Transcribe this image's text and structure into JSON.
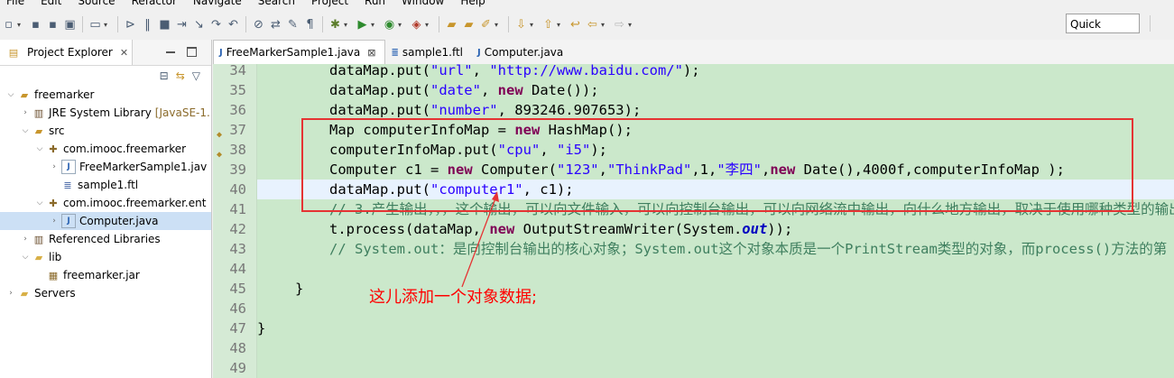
{
  "menu": [
    "File",
    "Edit",
    "Source",
    "Refactor",
    "Navigate",
    "Search",
    "Project",
    "Run",
    "Window",
    "Help"
  ],
  "toolbar": {
    "quick_access": "Quick Access"
  },
  "explorer": {
    "title": "Project Explorer",
    "tree": [
      {
        "label": "freemarker",
        "depth": 0,
        "twisty": "open",
        "icon": "project-icon"
      },
      {
        "label": "JRE System Library",
        "suffix": "[JavaSE-1.",
        "depth": 1,
        "twisty": "closed",
        "icon": "library-icon"
      },
      {
        "label": "src",
        "depth": 1,
        "twisty": "open",
        "icon": "source-folder-icon"
      },
      {
        "label": "com.imooc.freemarker",
        "depth": 2,
        "twisty": "open",
        "icon": "package-icon"
      },
      {
        "label": "FreeMarkerSample1.jav",
        "depth": 3,
        "twisty": "closed",
        "icon": "java-file-icon"
      },
      {
        "label": "sample1.ftl",
        "depth": 3,
        "twisty": "none",
        "icon": "ftl-file-icon"
      },
      {
        "label": "com.imooc.freemarker.ent",
        "depth": 2,
        "twisty": "open",
        "icon": "package-icon"
      },
      {
        "label": "Computer.java",
        "depth": 3,
        "twisty": "closed",
        "icon": "java-file-icon",
        "selected": true
      },
      {
        "label": "Referenced Libraries",
        "depth": 1,
        "twisty": "closed",
        "icon": "library-icon"
      },
      {
        "label": "lib",
        "depth": 1,
        "twisty": "open",
        "icon": "folder-icon"
      },
      {
        "label": "freemarker.jar",
        "depth": 2,
        "twisty": "none",
        "icon": "jar-icon"
      },
      {
        "label": "Servers",
        "depth": 0,
        "twisty": "closed",
        "icon": "folder-icon"
      }
    ]
  },
  "editor": {
    "tabs": [
      {
        "label": "FreeMarkerSample1.java",
        "active": true,
        "close": "⊠"
      },
      {
        "label": "sample1.ftl",
        "active": false
      },
      {
        "label": "Computer.java",
        "active": false
      }
    ],
    "lines": [
      {
        "n": "34",
        "indent": 2,
        "segs": [
          [
            "",
            "dataMap.put("
          ],
          [
            "str",
            "\"url\""
          ],
          [
            "",
            ", "
          ],
          [
            "str",
            "\"http://www.baidu.com/\""
          ],
          [
            "",
            ");"
          ]
        ]
      },
      {
        "n": "35",
        "indent": 2,
        "segs": [
          [
            "",
            "dataMap.put("
          ],
          [
            "str",
            "\"date\""
          ],
          [
            "",
            ", "
          ],
          [
            "kw",
            "new"
          ],
          [
            "",
            " Date());"
          ]
        ]
      },
      {
        "n": "36",
        "indent": 2,
        "segs": [
          [
            "",
            "dataMap.put("
          ],
          [
            "str",
            "\"number\""
          ],
          [
            "",
            ", 893246.907653);"
          ]
        ]
      },
      {
        "n": "37",
        "indent": 2,
        "mark": true,
        "segs": [
          [
            "",
            "Map computerInfoMap = "
          ],
          [
            "kw",
            "new"
          ],
          [
            "",
            " HashMap();"
          ]
        ]
      },
      {
        "n": "38",
        "indent": 2,
        "mark": true,
        "segs": [
          [
            "",
            "computerInfoMap.put("
          ],
          [
            "str",
            "\"cpu\""
          ],
          [
            "",
            ", "
          ],
          [
            "str",
            "\"i5\""
          ],
          [
            "",
            ");"
          ]
        ]
      },
      {
        "n": "39",
        "indent": 2,
        "segs": [
          [
            "",
            "Computer c1 = "
          ],
          [
            "kw",
            "new"
          ],
          [
            "",
            " Computer("
          ],
          [
            "str",
            "\"123\""
          ],
          [
            "",
            ","
          ],
          [
            "str",
            "\"ThinkPad\""
          ],
          [
            "",
            ",1,"
          ],
          [
            "str",
            "\"李四\""
          ],
          [
            "",
            ","
          ],
          [
            "kw",
            "new"
          ],
          [
            "",
            " Date(),4000f,computerInfoMap );"
          ]
        ]
      },
      {
        "n": "40",
        "indent": 2,
        "current": true,
        "segs": [
          [
            "",
            "dataMap.put("
          ],
          [
            "str",
            "\"computer1\""
          ],
          [
            "",
            ", c1);"
          ]
        ]
      },
      {
        "n": "41",
        "indent": 2,
        "segs": [
          [
            "cm",
            "// 3.产生输出，，，这个输出，可以向文件输入，可以向控制台输出，可以向网络流中输出，向什么地方输出，取决于使用哪种类型的输出"
          ]
        ]
      },
      {
        "n": "42",
        "indent": 2,
        "segs": [
          [
            "",
            "t.process(dataMap, "
          ],
          [
            "kw",
            "new"
          ],
          [
            "",
            " OutputStreamWriter(System."
          ],
          [
            "fld",
            "out"
          ],
          [
            "",
            "));"
          ]
        ]
      },
      {
        "n": "43",
        "indent": 2,
        "segs": [
          [
            "cm",
            "// System.out：是向控制台输出的核心对象；System.out这个对象本质是一个PrintStream类型的对象，而process()方法的第"
          ]
        ]
      },
      {
        "n": "44",
        "indent": 2,
        "segs": []
      },
      {
        "n": "45",
        "indent": 1,
        "segs": [
          [
            "",
            "}"
          ]
        ]
      },
      {
        "n": "46",
        "indent": 1,
        "segs": []
      },
      {
        "n": "47",
        "indent": 0,
        "segs": [
          [
            "",
            "}"
          ]
        ]
      },
      {
        "n": "48",
        "indent": 0,
        "segs": []
      },
      {
        "n": "49",
        "indent": 0,
        "segs": []
      }
    ]
  },
  "annotation": {
    "text": "这儿添加一个对象数据;",
    "color": "#ff0000"
  }
}
